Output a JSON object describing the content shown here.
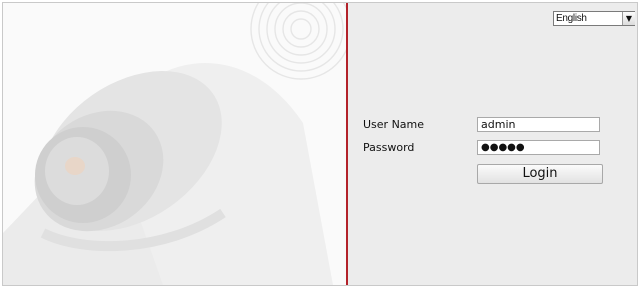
{
  "language": {
    "selected": "English"
  },
  "login": {
    "username_label": "User Name",
    "username_value": "admin",
    "password_label": "Password",
    "password_value": "●●●●●",
    "button_label": "Login"
  },
  "colors": {
    "accent": "#b3222a",
    "panel": "#ececec"
  }
}
